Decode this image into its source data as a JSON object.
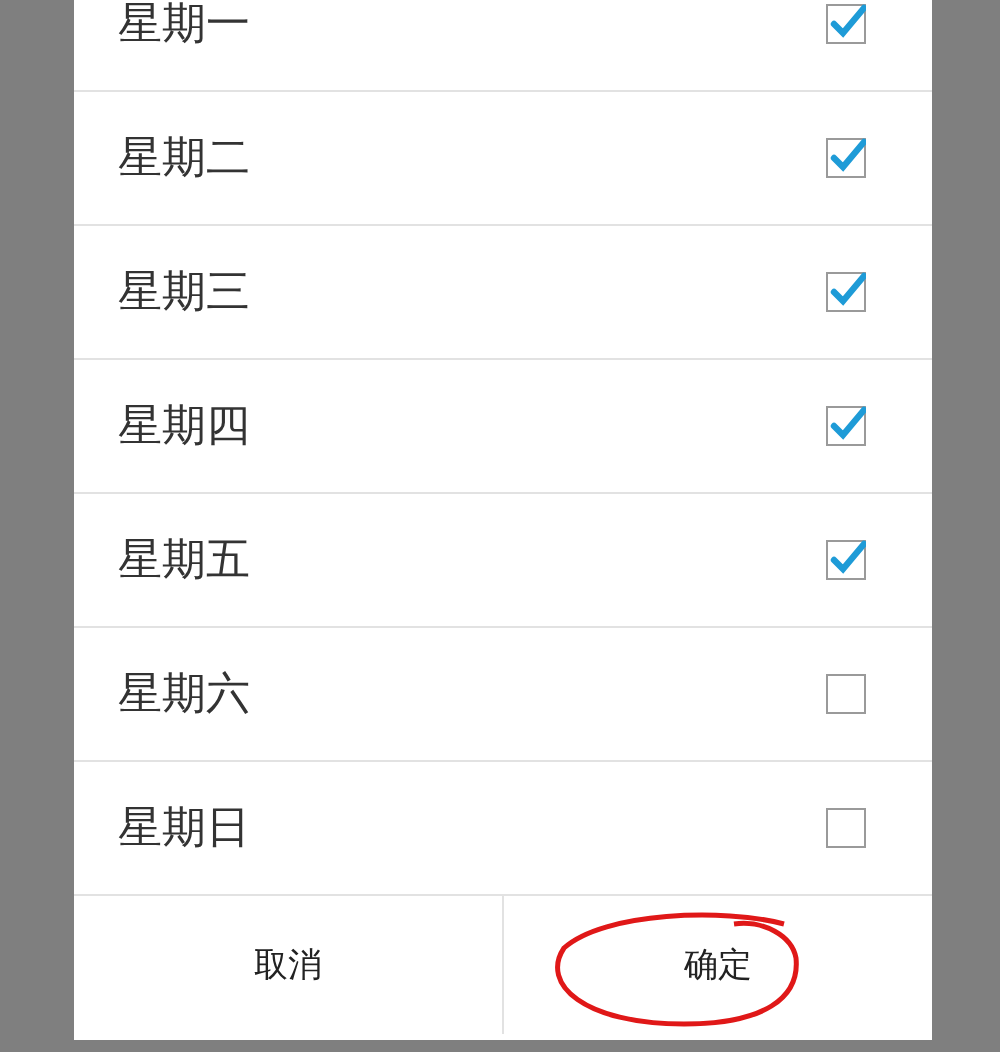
{
  "days": [
    {
      "label": "星期一",
      "checked": true
    },
    {
      "label": "星期二",
      "checked": true
    },
    {
      "label": "星期三",
      "checked": true
    },
    {
      "label": "星期四",
      "checked": true
    },
    {
      "label": "星期五",
      "checked": true
    },
    {
      "label": "星期六",
      "checked": false
    },
    {
      "label": "星期日",
      "checked": false
    }
  ],
  "buttons": [
    {
      "label": "取消",
      "circled": false
    },
    {
      "label": "确定",
      "circled": true
    }
  ]
}
